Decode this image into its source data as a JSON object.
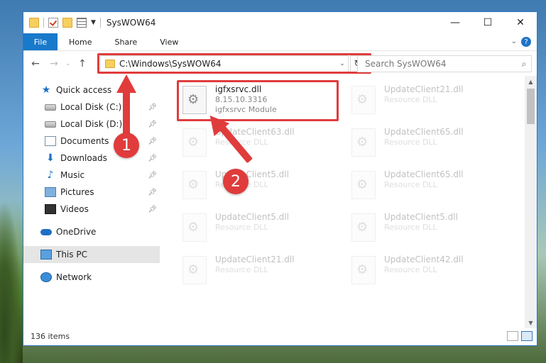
{
  "window": {
    "title": "SysWOW64",
    "minimize_glyph": "—",
    "maximize_glyph": "☐",
    "close_glyph": "✕"
  },
  "ribbon": {
    "tabs": [
      "File",
      "Home",
      "Share",
      "View"
    ]
  },
  "address_bar": {
    "path": "C:\\Windows\\SysWOW64",
    "dropdown_glyph": "⌄",
    "refresh_glyph": "↻"
  },
  "search": {
    "placeholder": "Search SysWOW64"
  },
  "sidebar": {
    "items": [
      {
        "label": "Quick access"
      },
      {
        "label": "Local Disk (C:)"
      },
      {
        "label": "Local Disk (D:)"
      },
      {
        "label": "Documents"
      },
      {
        "label": "Downloads"
      },
      {
        "label": "Music"
      },
      {
        "label": "Pictures"
      },
      {
        "label": "Videos"
      },
      {
        "label": "OneDrive"
      },
      {
        "label": "This PC"
      },
      {
        "label": "Network"
      }
    ]
  },
  "files": [
    {
      "name": "igfxsrvc.dll",
      "line2": "8.15.10.3316",
      "line3": "igfxsrvc Module"
    },
    {
      "name": "UpdateClient21.dll",
      "line2": "Resource DLL"
    },
    {
      "name": "UpdateClient63.dll",
      "line2": "Resource DLL"
    },
    {
      "name": "UpdateClient65.dll",
      "line2": "Resource DLL"
    },
    {
      "name": "UpdateClient5.dll",
      "line2": "Resource DLL"
    },
    {
      "name": "UpdateClient65.dll",
      "line2": "Resource DLL"
    },
    {
      "name": "UpdateClient5.dll",
      "line2": "Resource DLL"
    },
    {
      "name": "UpdateClient5.dll",
      "line2": "Resource DLL"
    },
    {
      "name": "UpdateClient21.dll",
      "line2": "Resource DLL"
    },
    {
      "name": "UpdateClient42.dll",
      "line2": "Resource DLL"
    }
  ],
  "status": {
    "item_count": "136 items"
  },
  "annotations": {
    "step1": "1",
    "step2": "2",
    "color": "#e03c3c"
  }
}
